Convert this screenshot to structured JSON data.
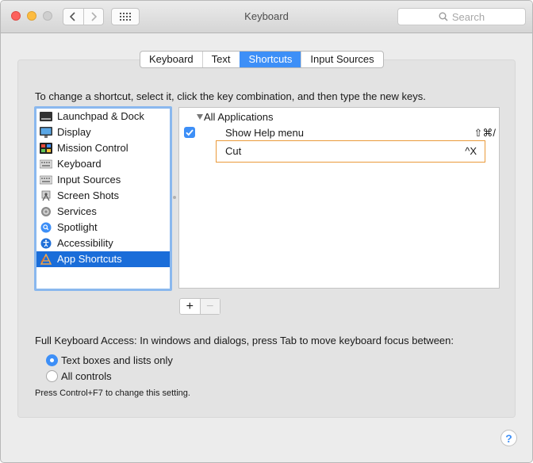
{
  "window": {
    "title": "Keyboard"
  },
  "search": {
    "placeholder": "Search"
  },
  "tabs": [
    "Keyboard",
    "Text",
    "Shortcuts",
    "Input Sources"
  ],
  "active_tab": "Shortcuts",
  "instruction": "To change a shortcut, select it, click the key combination, and then type the new keys.",
  "categories": [
    {
      "label": "Launchpad & Dock",
      "icon": "launchpad-dock-icon"
    },
    {
      "label": "Display",
      "icon": "display-icon"
    },
    {
      "label": "Mission Control",
      "icon": "mission-control-icon"
    },
    {
      "label": "Keyboard",
      "icon": "keyboard-icon"
    },
    {
      "label": "Input Sources",
      "icon": "input-sources-icon"
    },
    {
      "label": "Screen Shots",
      "icon": "screen-shots-icon"
    },
    {
      "label": "Services",
      "icon": "services-gear-icon"
    },
    {
      "label": "Spotlight",
      "icon": "spotlight-icon"
    },
    {
      "label": "Accessibility",
      "icon": "accessibility-icon"
    },
    {
      "label": "App Shortcuts",
      "icon": "app-shortcuts-icon",
      "selected": true
    }
  ],
  "shortcuts": {
    "group": "All Applications",
    "rows": [
      {
        "label": "Show Help menu",
        "keys": "⇧⌘/",
        "checked": true
      },
      {
        "label": "Cut",
        "keys": "^X",
        "editing": true
      }
    ]
  },
  "buttons": {
    "add": "+",
    "remove": "−"
  },
  "keyboard_access": {
    "label": "Full Keyboard Access: In windows and dialogs, press Tab to move keyboard focus between:",
    "options": [
      {
        "label": "Text boxes and lists only",
        "selected": true
      },
      {
        "label": "All controls",
        "selected": false
      }
    ],
    "hint": "Press Control+F7 to change this setting."
  },
  "help": "?",
  "colors": {
    "accent": "#3d8ff7",
    "selection": "#1a6dd9",
    "edit_border": "#ea9a3b"
  }
}
